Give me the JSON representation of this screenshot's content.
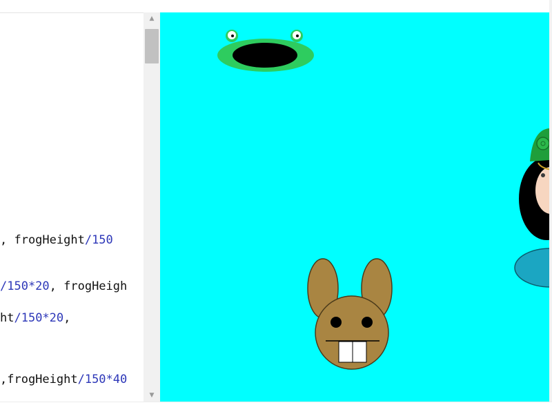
{
  "editor": {
    "code_lines": [
      {
        "segments": [
          {
            "text": ", frogHeight",
            "color": "#111111"
          },
          {
            "text": "/150",
            "color": "#2d37b8"
          }
        ]
      },
      {
        "segments": [
          {
            "text": "/150*20",
            "color": "#2d37b8"
          },
          {
            "text": ", frogHeigh",
            "color": "#111111"
          }
        ]
      },
      {
        "segments": [
          {
            "text": "ht",
            "color": "#111111"
          },
          {
            "text": "/150*20",
            "color": "#2d37b8"
          },
          {
            "text": ",",
            "color": "#111111"
          }
        ]
      },
      {
        "segments": [
          {
            "text": ",frogHeight",
            "color": "#111111"
          },
          {
            "text": "/150*40",
            "color": "#2d37b8"
          }
        ]
      }
    ]
  },
  "scrollbar": {
    "up_icon": "▲",
    "down_icon": "▼"
  },
  "canvas": {
    "background": "#00ffff",
    "characters": [
      "frog",
      "rabbit",
      "girl"
    ]
  },
  "colors": {
    "frog_body": "#2ecc5f",
    "frog_mouth": "#000000",
    "rabbit_fur": "#a98542",
    "rabbit_outline": "#4a3a1a",
    "girl_hat": "#1f9e3b",
    "girl_hair": "#000000",
    "girl_skin": "#f7d6c0",
    "girl_dress": "#1ba6c2"
  }
}
